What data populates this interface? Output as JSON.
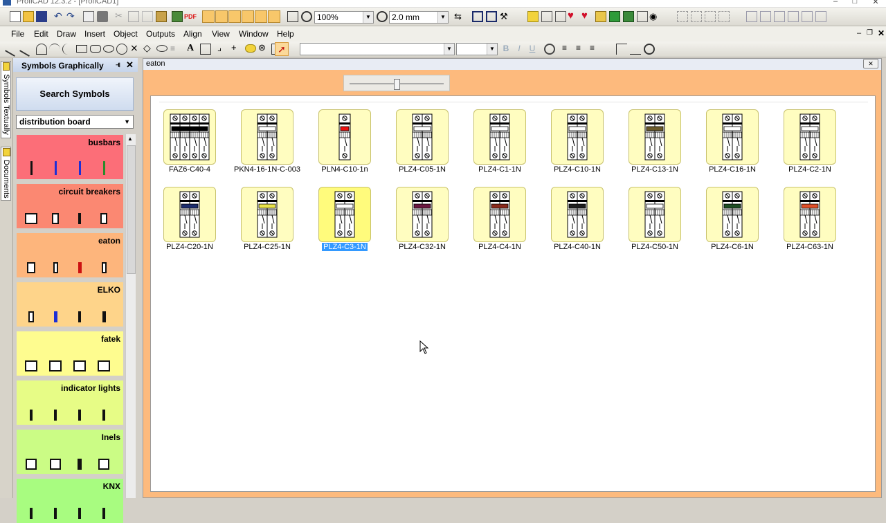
{
  "window": {
    "title": "ProfiCAD 12.3.2 - [ProfiCAD1]"
  },
  "toolbar": {
    "zoom_value": "100%",
    "grid_value": "2.0 mm",
    "pdf_label": "PDF"
  },
  "menu": {
    "items": [
      "File",
      "Edit",
      "Draw",
      "Insert",
      "Object",
      "Outputs",
      "Align",
      "View",
      "Window",
      "Help"
    ]
  },
  "side_tabs": {
    "symbols_textually": "Symbols Textually",
    "documents": "Documents"
  },
  "panel": {
    "title": "Symbols Graphically",
    "search_button": "Search Symbols",
    "category_select": "distribution board",
    "categories": [
      {
        "label": "busbars",
        "color": "#fc6e78"
      },
      {
        "label": "circuit breakers",
        "color": "#fb8872"
      },
      {
        "label": "eaton",
        "color": "#fdb57c"
      },
      {
        "label": "ELKO",
        "color": "#fed48a"
      },
      {
        "label": "fatek",
        "color": "#fefc8f"
      },
      {
        "label": "indicator lights",
        "color": "#e7fc86"
      },
      {
        "label": "Inels",
        "color": "#cbfc85"
      },
      {
        "label": "KNX",
        "color": "#a8fc80"
      }
    ]
  },
  "document": {
    "title": "eaton",
    "symbols": [
      {
        "label": "FAZ6-C40-4",
        "accent": "#000000",
        "selected": false
      },
      {
        "label": "PKN4-16-1N-C-003",
        "accent": "#ffffff",
        "selected": false
      },
      {
        "label": "PLN4-C10-1n",
        "accent": "#ee1111",
        "selected": false
      },
      {
        "label": "PLZ4-C05-1N",
        "accent": "#ffffff",
        "selected": false
      },
      {
        "label": "PLZ4-C1-1N",
        "accent": "#ffffff",
        "selected": false
      },
      {
        "label": "PLZ4-C10-1N",
        "accent": "#ffffff",
        "selected": false
      },
      {
        "label": "PLZ4-C13-1N",
        "accent": "#6b5a2a",
        "selected": false
      },
      {
        "label": "PLZ4-C16-1N",
        "accent": "#ffffff",
        "selected": false
      },
      {
        "label": "PLZ4-C2-1N",
        "accent": "#ffffff",
        "selected": false
      },
      {
        "label": "PLZ4-C20-1N",
        "accent": "#1d2d6e",
        "selected": false
      },
      {
        "label": "PLZ4-C25-1N",
        "accent": "#e9e34a",
        "selected": false
      },
      {
        "label": "PLZ4-C3-1N",
        "accent": "#ffffff",
        "selected": true
      },
      {
        "label": "PLZ4-C32-1N",
        "accent": "#6b1840",
        "selected": false
      },
      {
        "label": "PLZ4-C4-1N",
        "accent": "#8a2a1c",
        "selected": false
      },
      {
        "label": "PLZ4-C40-1N",
        "accent": "#1e1e1e",
        "selected": false
      },
      {
        "label": "PLZ4-C50-1N",
        "accent": "#ffffff",
        "selected": false
      },
      {
        "label": "PLZ4-C6-1N",
        "accent": "#1e4d23",
        "selected": false
      },
      {
        "label": "PLZ4-C63-1N",
        "accent": "#e0502a",
        "selected": false
      }
    ]
  }
}
